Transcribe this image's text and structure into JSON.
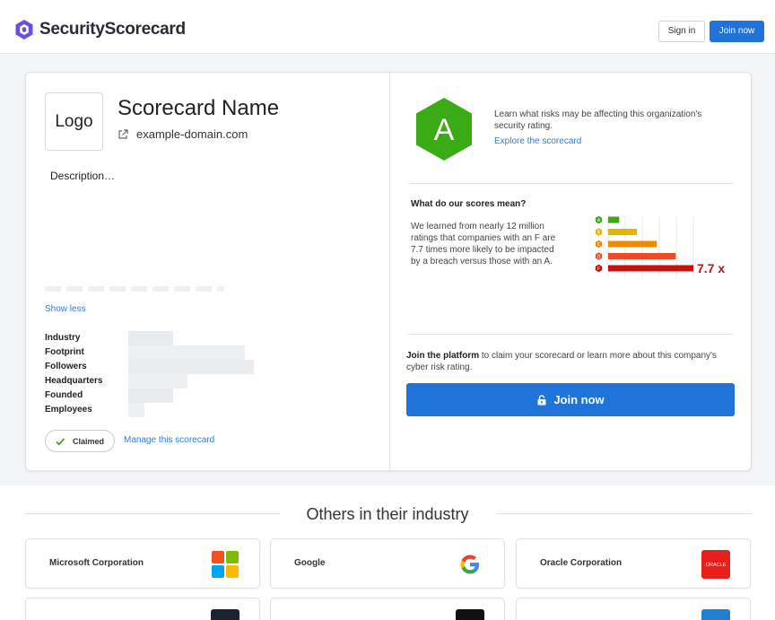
{
  "header": {
    "brand": "SecurityScorecard",
    "sign_in": "Sign in",
    "join_now": "Join now"
  },
  "profile": {
    "logo_text": "Logo",
    "name": "Scorecard Name",
    "domain": "example-domain.com",
    "description": "Description…",
    "show_less": "Show less",
    "attributes": [
      "Industry",
      "Footprint",
      "Followers",
      "Headquarters",
      "Founded",
      "Employees"
    ],
    "claimed": "Claimed",
    "manage": "Manage this scorecard"
  },
  "rating": {
    "grade": "A",
    "grade_color": "#3aaa16",
    "info": "Learn what risks may be affecting this organization's security rating.",
    "explore": "Explore the scorecard"
  },
  "scores": {
    "title": "What do our scores mean?",
    "body": "We learned from nearly 12 million ratings that companies with an F are 7.7 times more likely to be impacted by a breach versus those with an A.",
    "multiplier": "7.7 x",
    "levels": [
      {
        "grade": "A",
        "color": "#3aaa16",
        "value": 1
      },
      {
        "grade": "B",
        "color": "#e6b400",
        "value": 2.6
      },
      {
        "grade": "C",
        "color": "#f08a00",
        "value": 4.4
      },
      {
        "grade": "D",
        "color": "#ee4a2a",
        "value": 6.1
      },
      {
        "grade": "F",
        "color": "#c4120f",
        "value": 7.7
      }
    ]
  },
  "platform": {
    "bold": "Join the platform",
    "rest": " to claim your scorecard or learn more about this company's cyber risk rating.",
    "join_button": "Join now"
  },
  "others": {
    "title": "Others in their industry",
    "companies": [
      {
        "name": "Microsoft Corporation",
        "logo": "microsoft-logo"
      },
      {
        "name": "Google",
        "logo": "google-logo"
      },
      {
        "name": "Oracle Corporation",
        "logo": "oracle-logo",
        "logo_text": "ORACLE"
      }
    ]
  }
}
